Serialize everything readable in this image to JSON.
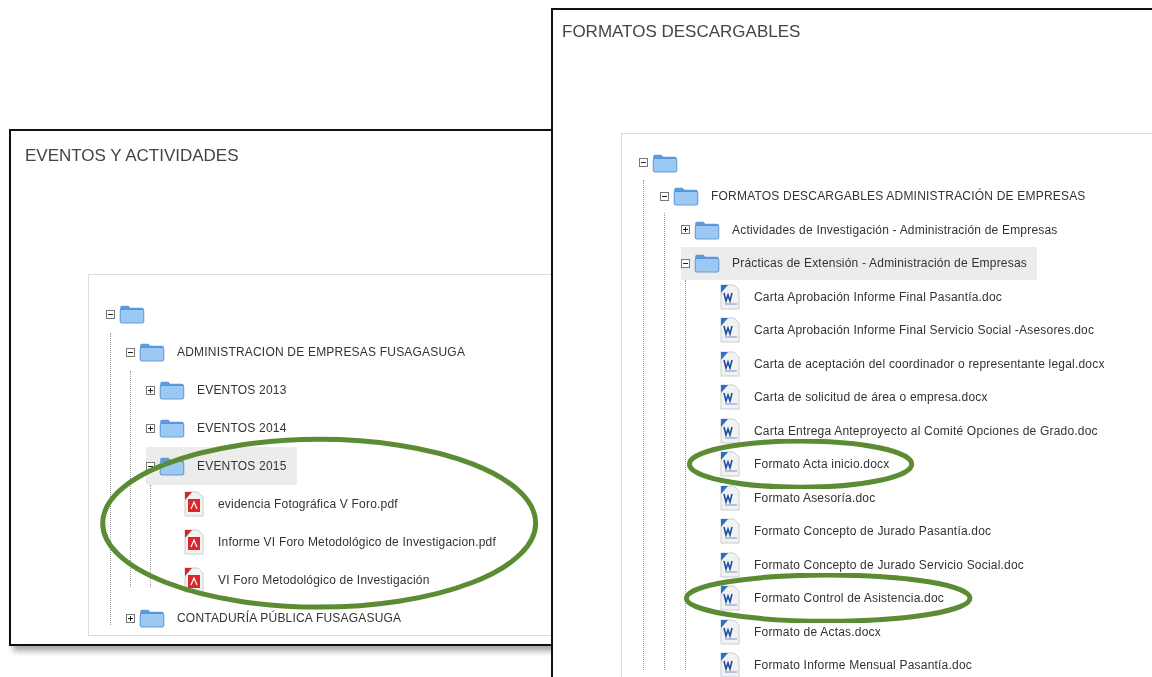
{
  "panels": [
    {
      "title": "EVENTOS Y ACTIVIDADES",
      "tree": [
        {
          "kind": "folder",
          "expanded": true,
          "selected": false,
          "children": [
            {
              "kind": "folder",
              "label": "ADMINISTRACION DE EMPRESAS FUSAGASUGA",
              "expanded": true,
              "selected": false,
              "children": [
                {
                  "kind": "folder",
                  "label": "EVENTOS 2013",
                  "expanded": false,
                  "selected": false
                },
                {
                  "kind": "folder",
                  "label": "EVENTOS 2014",
                  "expanded": false,
                  "selected": false
                },
                {
                  "kind": "folder",
                  "label": "EVENTOS 2015",
                  "expanded": true,
                  "selected": true,
                  "circled": true,
                  "children": [
                    {
                      "kind": "pdf",
                      "label": "evidencia Fotográfica V Foro.pdf",
                      "selected": false
                    },
                    {
                      "kind": "pdf",
                      "label": "Informe VI Foro Metodológico de Investigacion.pdf",
                      "selected": false
                    },
                    {
                      "kind": "pdf",
                      "label": "VI Foro Metodológico de Investigación",
                      "selected": false
                    }
                  ]
                }
              ]
            },
            {
              "kind": "folder",
              "label": "CONTADURÍA PÚBLICA FUSAGASUGA",
              "expanded": false,
              "selected": false
            }
          ]
        }
      ]
    },
    {
      "title": "FORMATOS DESCARGABLES",
      "tree": [
        {
          "kind": "folder",
          "expanded": true,
          "selected": false,
          "children": [
            {
              "kind": "folder",
              "label": "FORMATOS DESCARGABLES ADMINISTRACIÓN DE EMPRESAS",
              "expanded": true,
              "selected": false,
              "children": [
                {
                  "kind": "folder",
                  "label": "Actividades de Investigación - Administración de Empresas",
                  "expanded": false,
                  "selected": false
                },
                {
                  "kind": "folder",
                  "label": "Prácticas de Extensión - Administración de Empresas",
                  "expanded": true,
                  "selected": true,
                  "children": [
                    {
                      "kind": "doc",
                      "label": "Carta Aprobación Informe Final Pasantía.doc",
                      "selected": false
                    },
                    {
                      "kind": "doc",
                      "label": "Carta Aprobación Informe Final Servicio Social -Asesores.doc",
                      "selected": false
                    },
                    {
                      "kind": "doc",
                      "label": "Carta de aceptación del coordinador o representante legal.docx",
                      "selected": false
                    },
                    {
                      "kind": "doc",
                      "label": "Carta de solicitud de área o empresa.docx",
                      "selected": false
                    },
                    {
                      "kind": "doc",
                      "label": "Carta Entrega Anteproyecto al Comité Opciones de Grado.doc",
                      "selected": false
                    },
                    {
                      "kind": "doc",
                      "label": "Formato Acta inicio.docx",
                      "selected": false,
                      "circled": true
                    },
                    {
                      "kind": "doc",
                      "label": "Formato Asesoría.doc",
                      "selected": false
                    },
                    {
                      "kind": "doc",
                      "label": "Formato Concepto de Jurado Pasantía.doc",
                      "selected": false
                    },
                    {
                      "kind": "doc",
                      "label": "Formato Concepto de Jurado Servicio Social.doc",
                      "selected": false
                    },
                    {
                      "kind": "doc",
                      "label": "Formato Control de Asistencia.doc",
                      "selected": false,
                      "circled": true
                    },
                    {
                      "kind": "doc",
                      "label": "Formato de Actas.docx",
                      "selected": false
                    },
                    {
                      "kind": "doc",
                      "label": "Formato Informe Mensual Pasantía.doc",
                      "selected": false
                    }
                  ]
                }
              ]
            }
          ]
        }
      ]
    }
  ]
}
